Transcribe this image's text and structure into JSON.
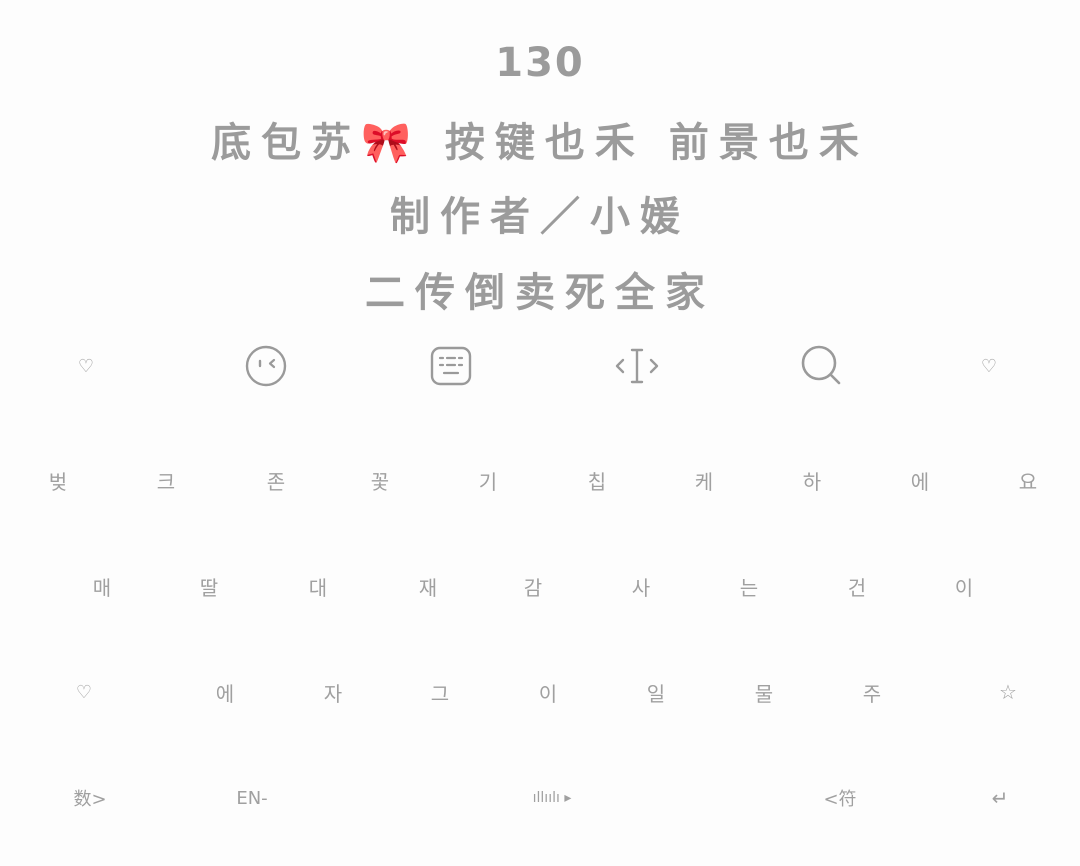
{
  "header": {
    "number": "130",
    "credits": "底包苏🎀 按键也禾 前景也禾",
    "author": "制作者／小媛",
    "notice": "二传倒卖死全家"
  },
  "toolbar": {
    "left_heart": "♡",
    "right_heart": "♡",
    "icons": [
      "heart-icon",
      "emoji-icon",
      "keyboard-layout-icon",
      "cursor-move-icon",
      "search-icon",
      "heart-icon"
    ]
  },
  "keyboard": {
    "row1": [
      "벚",
      "크",
      "존",
      "꽃",
      "기",
      "칩",
      "케",
      "하",
      "에",
      "요"
    ],
    "row2": [
      "매",
      "딸",
      "대",
      "재",
      "감",
      "사",
      "는",
      "건",
      "이"
    ],
    "row3_left": "♡",
    "row3": [
      "에",
      "자",
      "그",
      "이",
      "일",
      "물",
      "주"
    ],
    "row3_right": "☆",
    "bottom": {
      "numbers": "数>",
      "language": "EN-",
      "space": "ıllıılı ▸",
      "symbols": "<符",
      "enter": "↵"
    }
  },
  "colors": {
    "background": "#fdfdfd",
    "text": "#9b9b9b"
  }
}
